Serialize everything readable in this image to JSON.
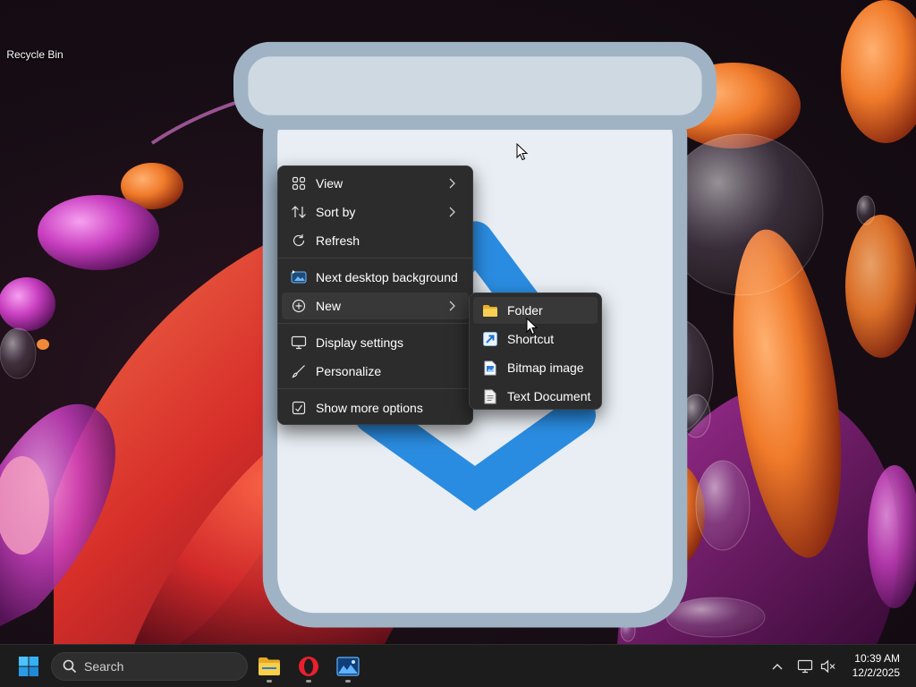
{
  "desktop": {
    "icons": [
      {
        "label": "Recycle Bin",
        "icon": "recycle-bin-icon"
      }
    ]
  },
  "context_menu": {
    "items": [
      {
        "label": "View",
        "icon": "view-grid-icon",
        "submenu": true
      },
      {
        "label": "Sort by",
        "icon": "sort-icon",
        "submenu": true
      },
      {
        "label": "Refresh",
        "icon": "refresh-icon"
      },
      {
        "label": "Next desktop background",
        "icon": "next-background-icon"
      },
      {
        "label": "New",
        "icon": "new-plus-icon",
        "submenu": true,
        "active": true
      },
      {
        "label": "Display settings",
        "icon": "display-icon"
      },
      {
        "label": "Personalize",
        "icon": "brush-icon"
      },
      {
        "label": "Show more options",
        "icon": "show-more-icon"
      }
    ]
  },
  "new_submenu": {
    "items": [
      {
        "label": "Folder",
        "icon": "folder-icon",
        "active": true
      },
      {
        "label": "Shortcut",
        "icon": "shortcut-icon"
      },
      {
        "label": "Bitmap image",
        "icon": "bitmap-icon"
      },
      {
        "label": "Text Document",
        "icon": "text-document-icon"
      }
    ]
  },
  "taskbar": {
    "search_label": "Search",
    "apps": [
      {
        "name": "File Explorer",
        "icon": "file-explorer-icon"
      },
      {
        "name": "Opera",
        "icon": "opera-icon"
      },
      {
        "name": "Photos",
        "icon": "photos-icon"
      }
    ],
    "clock": {
      "time": "10:39 AM",
      "date": "12/2/2025"
    }
  },
  "colors": {
    "menu_bg": "#2c2c2c",
    "menu_hover": "#383838",
    "taskbar_bg": "#1c1c1c",
    "accent_blue": "#3aa0f0",
    "folder_yellow": "#f5c542",
    "opera_red": "#e8202e"
  }
}
